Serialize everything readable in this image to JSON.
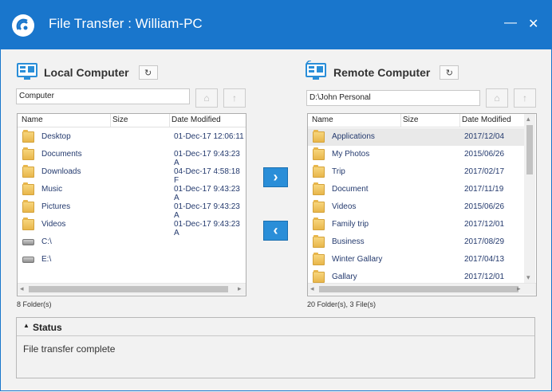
{
  "window": {
    "title": "File Transfer : William-PC"
  },
  "local": {
    "label": "Local Computer",
    "path": "Computer",
    "columns": [
      "Name",
      "Size",
      "Date Modified"
    ],
    "rows": [
      {
        "name": "Desktop",
        "size": "",
        "date": "01-Dec-17 12:06:11",
        "type": "folder"
      },
      {
        "name": "Documents",
        "size": "",
        "date": "01-Dec-17 9:43:23 A",
        "type": "folder"
      },
      {
        "name": "Downloads",
        "size": "",
        "date": "04-Dec-17 4:58:18 F",
        "type": "folder"
      },
      {
        "name": "Music",
        "size": "",
        "date": "01-Dec-17 9:43:23 A",
        "type": "folder"
      },
      {
        "name": "Pictures",
        "size": "",
        "date": "01-Dec-17 9:43:23 A",
        "type": "folder"
      },
      {
        "name": "Videos",
        "size": "",
        "date": "01-Dec-17 9:43:23 A",
        "type": "folder"
      },
      {
        "name": "C:\\",
        "size": "",
        "date": "",
        "type": "drive"
      },
      {
        "name": "E:\\",
        "size": "",
        "date": "",
        "type": "drive"
      }
    ],
    "count": "8 Folder(s)"
  },
  "remote": {
    "label": "Remote Computer",
    "path": "D:\\John Personal",
    "columns": [
      "Name",
      "Size",
      "Date Modified"
    ],
    "rows": [
      {
        "name": "Applications",
        "size": "",
        "date": "2017/12/04",
        "type": "folder",
        "selected": true
      },
      {
        "name": "My Photos",
        "size": "",
        "date": "2015/06/26",
        "type": "folder"
      },
      {
        "name": "Trip",
        "size": "",
        "date": "2017/02/17",
        "type": "folder"
      },
      {
        "name": "Document",
        "size": "",
        "date": "2017/11/19",
        "type": "folder"
      },
      {
        "name": "Videos",
        "size": "",
        "date": "2015/06/26",
        "type": "folder"
      },
      {
        "name": "Family trip",
        "size": "",
        "date": "2017/12/01",
        "type": "folder"
      },
      {
        "name": "Business",
        "size": "",
        "date": "2017/08/29",
        "type": "folder"
      },
      {
        "name": "Winter Gallary",
        "size": "",
        "date": "2017/04/13",
        "type": "folder"
      },
      {
        "name": "Gallary",
        "size": "",
        "date": "2017/12/01",
        "type": "folder"
      }
    ],
    "count": "20 Folder(s), 3 File(s)"
  },
  "status": {
    "label": "Status",
    "message": "File transfer complete"
  },
  "colors": {
    "titlebar": "#1976cc",
    "accent": "#2a8ed8"
  }
}
